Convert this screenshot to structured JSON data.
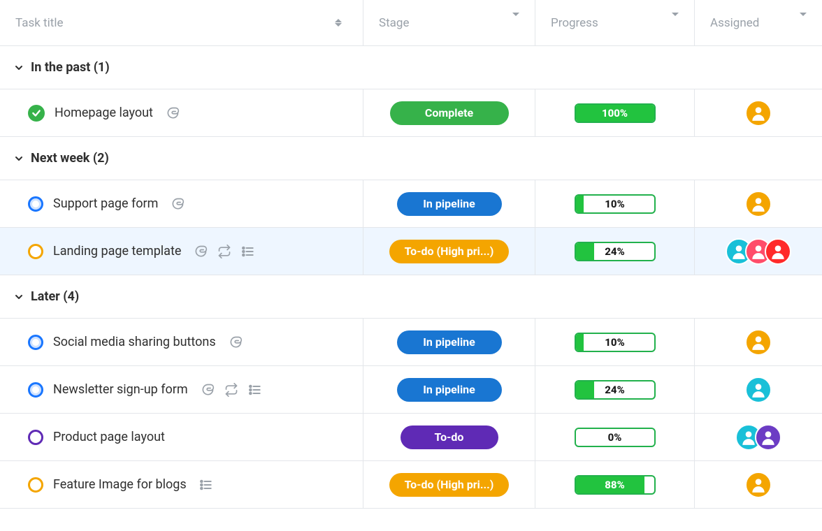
{
  "columns": {
    "title": "Task title",
    "stage": "Stage",
    "progress": "Progress",
    "assigned": "Assigned"
  },
  "groups": [
    {
      "id": "past",
      "label": "In the past (1)",
      "tasks": [
        {
          "id": "homepage",
          "title": "Homepage layout",
          "status": "done",
          "icons": [
            "attachment"
          ],
          "stage": {
            "label": "Complete",
            "color": "green"
          },
          "progress": 100,
          "assignees": [
            {
              "bg": "orange"
            }
          ]
        }
      ]
    },
    {
      "id": "nextweek",
      "label": "Next week (2)",
      "tasks": [
        {
          "id": "support",
          "title": "Support page form",
          "status": "blue",
          "icons": [
            "attachment"
          ],
          "stage": {
            "label": "In pipeline",
            "color": "blue"
          },
          "progress": 10,
          "assignees": [
            {
              "bg": "orange"
            }
          ]
        },
        {
          "id": "landing",
          "title": "Landing page template",
          "status": "orange",
          "highlight": true,
          "icons": [
            "attachment",
            "recurring",
            "list"
          ],
          "stage": {
            "label": "To-do (High pri...)",
            "color": "orange"
          },
          "progress": 24,
          "assignees": [
            {
              "bg": "teal"
            },
            {
              "bg": "pink"
            },
            {
              "bg": "red"
            }
          ]
        }
      ]
    },
    {
      "id": "later",
      "label": "Later (4)",
      "tasks": [
        {
          "id": "social",
          "title": "Social media sharing buttons",
          "status": "blue",
          "icons": [
            "attachment"
          ],
          "stage": {
            "label": "In pipeline",
            "color": "blue"
          },
          "progress": 10,
          "assignees": [
            {
              "bg": "orange"
            }
          ]
        },
        {
          "id": "newsletter",
          "title": "Newsletter sign-up form",
          "status": "blue",
          "icons": [
            "attachment",
            "recurring",
            "list"
          ],
          "stage": {
            "label": "In pipeline",
            "color": "blue"
          },
          "progress": 24,
          "assignees": [
            {
              "bg": "teal"
            }
          ]
        },
        {
          "id": "product",
          "title": "Product page layout",
          "status": "purple",
          "icons": [],
          "stage": {
            "label": "To-do",
            "color": "purple"
          },
          "progress": 0,
          "assignees": [
            {
              "bg": "teal"
            },
            {
              "bg": "purple"
            }
          ]
        },
        {
          "id": "feature",
          "title": "Feature Image for blogs",
          "status": "orange",
          "icons": [
            "list"
          ],
          "stage": {
            "label": "To-do (High pri...)",
            "color": "orange"
          },
          "progress": 88,
          "assignees": [
            {
              "bg": "orange"
            }
          ]
        }
      ]
    }
  ]
}
